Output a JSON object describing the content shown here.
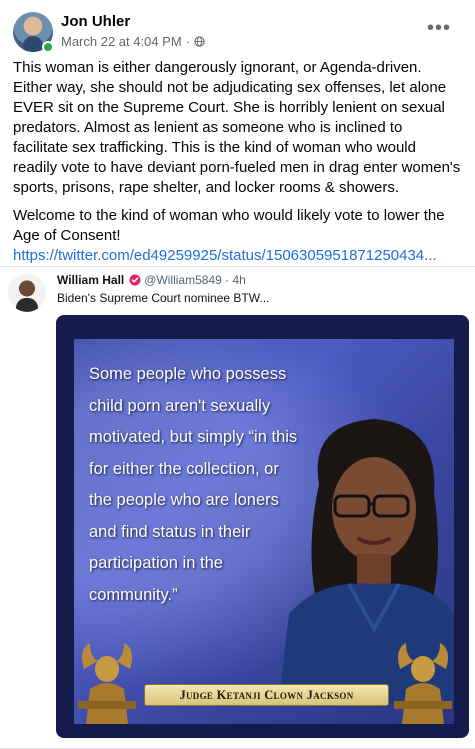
{
  "post": {
    "author": "Jon Uhler",
    "timestamp": "March 22 at 4:04 PM",
    "separator": "·",
    "more_icon": "more-horizontal-icon",
    "privacy_icon": "globe-icon",
    "paragraphs": [
      "This woman is either dangerously ignorant, or Agenda-driven. Either way, she should not be adjudicating sex offenses, let alone EVER sit on the Supreme Court. She is horribly lenient on sexual predators. Almost as lenient as someone who is inclined to facilitate sex trafficking.  This is the kind of woman who would readily vote to have deviant porn-fueled men in drag enter women's sports, prisons, rape shelter, and locker rooms & showers.",
      "Welcome to the kind of woman who would likely vote to lower the Age of Consent!"
    ],
    "link": "https://twitter.com/ed49259925/status/1506305951871250434..."
  },
  "tweet": {
    "name": "William Hall",
    "handle": "@William5849 · 4h",
    "text": "Biden's Supreme Court nominee BTW...",
    "verified_color": "#e0245e"
  },
  "meme": {
    "quote": "Some people who possess child porn aren't sexually motivated, but simply “in this for either the collection, or the people who are loners and find status in their participation in the community.”",
    "caption": "Judge Ketanji Clown Jackson"
  },
  "colors": {
    "link": "#216fdb",
    "online": "#31a24c",
    "meta": "#65676b"
  }
}
